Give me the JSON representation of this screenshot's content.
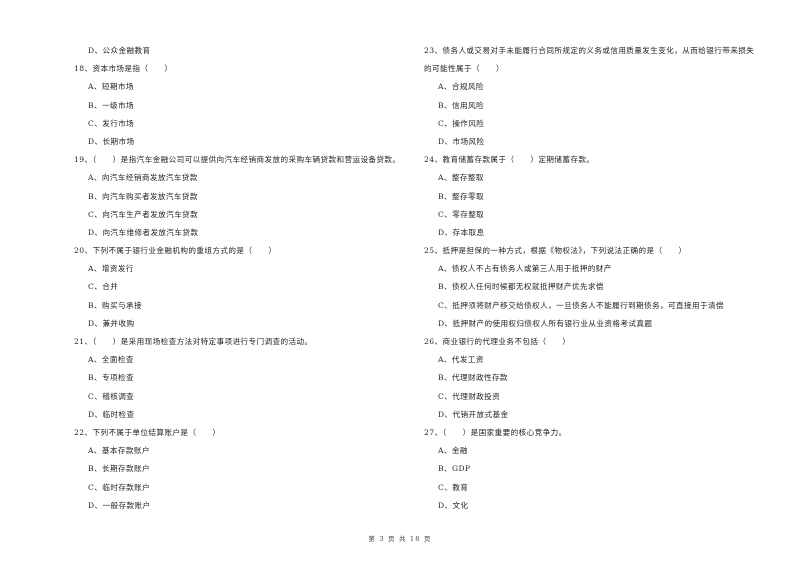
{
  "page": {
    "footer": "第 3 页 共 18 页"
  },
  "left_column": [
    {
      "type": "opt",
      "text": "D、公众金融教育"
    },
    {
      "type": "q",
      "text": "18、资本市场是指（　　）"
    },
    {
      "type": "opt",
      "text": "A、短期市场"
    },
    {
      "type": "opt",
      "text": "B、一级市场"
    },
    {
      "type": "opt",
      "text": "C、发行市场"
    },
    {
      "type": "opt",
      "text": "D、长期市场"
    },
    {
      "type": "q",
      "text": "19、（　　）是指汽车金融公司可以提供向汽车经销商发放的采购车辆贷款和营运设备贷款。"
    },
    {
      "type": "opt",
      "text": "A、向汽车经销商发放汽车贷款"
    },
    {
      "type": "opt",
      "text": "B、向汽车购买者发放汽车贷款"
    },
    {
      "type": "opt",
      "text": "C、向汽车生产者发放汽车贷款"
    },
    {
      "type": "opt",
      "text": "D、向汽车维修者发放汽车贷款"
    },
    {
      "type": "q",
      "text": "20、下列不属于银行业金融机构的重组方式的是（　　）"
    },
    {
      "type": "opt",
      "text": "A、增资发行"
    },
    {
      "type": "opt",
      "text": "C、合并"
    },
    {
      "type": "opt",
      "text": "B、购买与承接"
    },
    {
      "type": "opt",
      "text": "D、兼并收购"
    },
    {
      "type": "q",
      "text": "21、（　　）是采用现场检查方法对特定事项进行专门调查的活动。"
    },
    {
      "type": "opt",
      "text": "A、全面检查"
    },
    {
      "type": "opt",
      "text": "B、专项检查"
    },
    {
      "type": "opt",
      "text": "C、稽核调查"
    },
    {
      "type": "opt",
      "text": "D、临时检查"
    },
    {
      "type": "q",
      "text": "22、下列不属于单位结算账户是（　　）"
    },
    {
      "type": "opt",
      "text": "A、基本存款账户"
    },
    {
      "type": "opt",
      "text": "B、长期存款账户"
    },
    {
      "type": "opt",
      "text": "C、临时存款账户"
    },
    {
      "type": "opt",
      "text": "D、一般存款账户"
    }
  ],
  "right_column": [
    {
      "type": "q",
      "text": "23、债务人或交易对手未能履行合同所规定的义务或信用质量发生变化，从而给银行带来损失"
    },
    {
      "type": "q",
      "text": "的可能性属于（　　）"
    },
    {
      "type": "opt",
      "text": "A、合规风险"
    },
    {
      "type": "opt",
      "text": "B、信用风险"
    },
    {
      "type": "opt",
      "text": "C、操作风险"
    },
    {
      "type": "opt",
      "text": "D、市场风险"
    },
    {
      "type": "q",
      "text": "24、教育储蓄存款属于（　　）定期储蓄存款。"
    },
    {
      "type": "opt",
      "text": "A、整存整取"
    },
    {
      "type": "opt",
      "text": "B、整存零取"
    },
    {
      "type": "opt",
      "text": "C、零存整取"
    },
    {
      "type": "opt",
      "text": "D、存本取息"
    },
    {
      "type": "q",
      "text": "25、抵押是担保的一种方式，根据《物权法》，下列说法正确的是（　　）"
    },
    {
      "type": "opt",
      "text": "A、债权人不占有债务人或第三人用于抵押的财产"
    },
    {
      "type": "opt",
      "text": "B、债权人任何时候都无权就抵押财产优先求偿"
    },
    {
      "type": "opt",
      "text": "C、抵押须将财产移交给债权人，一旦债务人不能履行到期债务，可直接用于清偿"
    },
    {
      "type": "opt",
      "text": "D、抵押财产的使用权归债权人所有银行业从业资格考试真题"
    },
    {
      "type": "q",
      "text": "26、商业银行的代理业务不包括（　　）"
    },
    {
      "type": "opt",
      "text": "A、代发工资"
    },
    {
      "type": "opt",
      "text": "B、代理财政性存款"
    },
    {
      "type": "opt",
      "text": "C、代理财政投资"
    },
    {
      "type": "opt",
      "text": "D、代销开放式基金"
    },
    {
      "type": "q",
      "text": "27、（　　）是国家重要的核心竞争力。"
    },
    {
      "type": "opt",
      "text": "A、金融"
    },
    {
      "type": "opt",
      "text": "B、GDP"
    },
    {
      "type": "opt",
      "text": "C、教育"
    },
    {
      "type": "opt",
      "text": "D、文化"
    }
  ]
}
